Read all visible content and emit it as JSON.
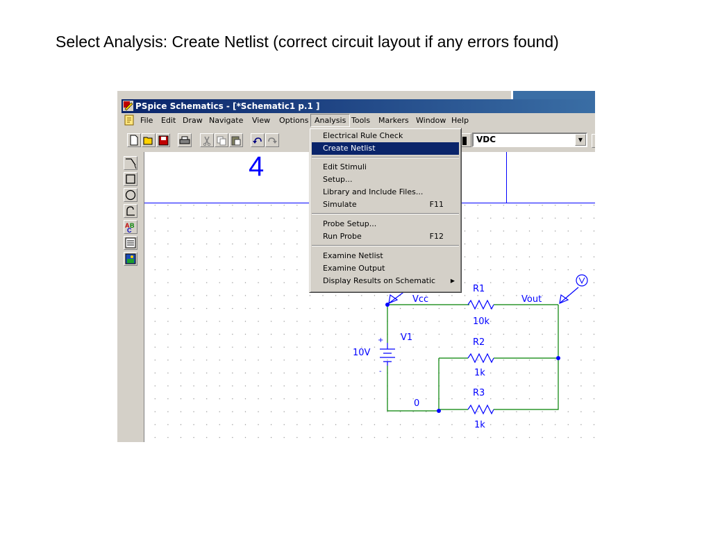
{
  "slide": {
    "caption": "Select Analysis: Create Netlist (correct circuit layout if any errors found)"
  },
  "window": {
    "title": "PSpice Schematics - [*Schematic1  p.1  ]",
    "app_icon": "pspice-icon"
  },
  "menubar": {
    "items": [
      "File",
      "Edit",
      "Draw",
      "Navigate",
      "View",
      "Options",
      "Analysis",
      "Tools",
      "Markers",
      "Window",
      "Help"
    ],
    "active": "Analysis"
  },
  "toolbar": {
    "part_combo_value": "VDC",
    "buttons": [
      "new-icon",
      "open-icon",
      "save-icon",
      "print-icon",
      "cut-icon",
      "copy-icon",
      "paste-icon",
      "undo-icon",
      "redo-icon"
    ]
  },
  "left_toolbar": {
    "tools": [
      "wire-icon",
      "box-icon",
      "circle-icon",
      "arc-icon",
      "text-icon",
      "textbox-icon",
      "insert-picture-icon"
    ]
  },
  "analysis_menu": {
    "items": [
      {
        "label": "Electrical Rule Check",
        "shortcut": ""
      },
      {
        "label": "Create Netlist",
        "shortcut": "",
        "selected": true
      },
      {
        "label": "Edit Stimuli",
        "shortcut": ""
      },
      {
        "label": "Setup...",
        "shortcut": ""
      },
      {
        "label": "Library and Include Files...",
        "shortcut": ""
      },
      {
        "label": "Simulate",
        "shortcut": "F11"
      },
      {
        "label": "Probe Setup...",
        "shortcut": ""
      },
      {
        "label": "Run Probe",
        "shortcut": "F12"
      },
      {
        "label": "Examine Netlist",
        "shortcut": ""
      },
      {
        "label": "Examine Output",
        "shortcut": ""
      },
      {
        "label": "Display Results on Schematic",
        "shortcut": "",
        "submenu": true
      }
    ]
  },
  "schematic": {
    "page_number": "4",
    "net_labels": {
      "vcc": "Vcc",
      "vout": "Vout",
      "ground": "0"
    },
    "source": {
      "name": "V1",
      "value": "10V",
      "plus": "+",
      "minus": "-"
    },
    "resistors": [
      {
        "name": "R1",
        "value": "10k"
      },
      {
        "name": "R2",
        "value": "1k"
      },
      {
        "name": "R3",
        "value": "1k"
      }
    ],
    "probe_symbol": "V",
    "colors": {
      "wire": "#008000",
      "part": "#0000ff",
      "node": "#0000ff"
    }
  }
}
